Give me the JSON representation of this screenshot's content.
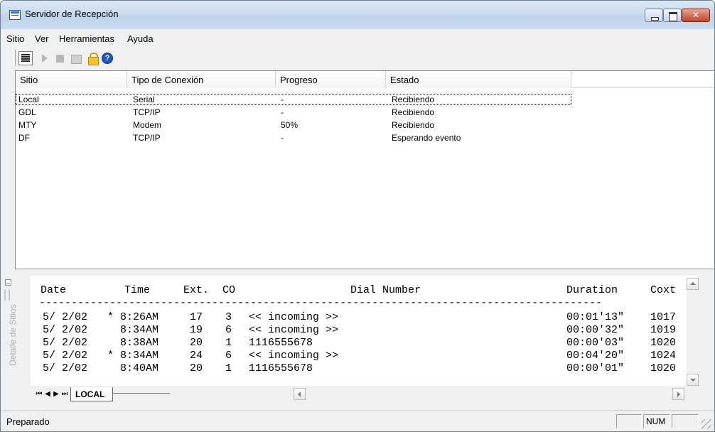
{
  "window": {
    "title": "Servidor de Recepción"
  },
  "menu": [
    "Sitio",
    "Ver",
    "Herramientas",
    "Ayuda"
  ],
  "toolbar": {
    "help_label": "?"
  },
  "list": {
    "columns": [
      "Sitio",
      "Tipo de Conexión",
      "Progreso",
      "Estado"
    ],
    "rows": [
      {
        "sitio": "Local",
        "tipo": "Serial",
        "progreso": "-",
        "estado": "Recibiendo"
      },
      {
        "sitio": "GDL",
        "tipo": "TCP/IP",
        "progreso": "-",
        "estado": "Recibiendo"
      },
      {
        "sitio": "MTY",
        "tipo": "Modem",
        "progreso": "50%",
        "estado": "Recibiendo"
      },
      {
        "sitio": "DF",
        "tipo": "TCP/IP",
        "progreso": "-",
        "estado": "Esperando evento"
      }
    ]
  },
  "side_panel": {
    "label": "Detalle de Sitios"
  },
  "detail": {
    "headers": {
      "date": "Date",
      "time": "Time",
      "ext": "Ext.",
      "co": "CO",
      "dial": "Dial Number",
      "duration": "Duration",
      "coxt": "Coxt"
    },
    "separator": "----------------------------------------------------------------------------------------",
    "rows": [
      {
        "date": "5/ 2/02",
        "time": "* 8:26AM",
        "ext": "17",
        "co": "3",
        "dial": "<< incoming >>",
        "duration": "00:01'13\"",
        "coxt": "1017"
      },
      {
        "date": "5/ 2/02",
        "time": "  8:34AM",
        "ext": "19",
        "co": "6",
        "dial": "<< incoming >>",
        "duration": "00:00'32\"",
        "coxt": "1019"
      },
      {
        "date": "5/ 2/02",
        "time": "  8:38AM",
        "ext": "20",
        "co": "1",
        "dial": "1116555678",
        "duration": "00:00'03\"",
        "coxt": "1020"
      },
      {
        "date": "5/ 2/02",
        "time": "* 8:34AM",
        "ext": "24",
        "co": "6",
        "dial": "<< incoming >>",
        "duration": "00:04'20\"",
        "coxt": "1024"
      },
      {
        "date": "5/ 2/02",
        "time": "  8:40AM",
        "ext": "20",
        "co": "1",
        "dial": "1116555678",
        "duration": "00:00'01\"",
        "coxt": "1020"
      }
    ]
  },
  "sheet_tab": {
    "label": "LOCAL"
  },
  "status": {
    "text": "Preparado",
    "num": "NUM"
  }
}
